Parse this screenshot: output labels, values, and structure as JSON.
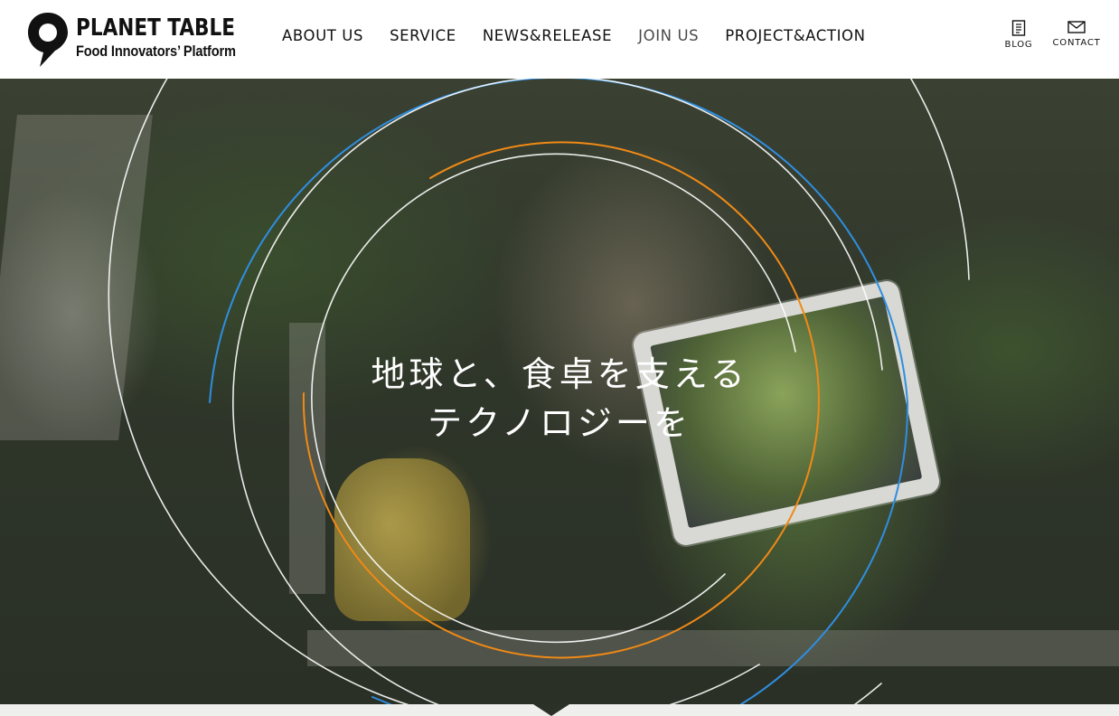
{
  "header": {
    "logo": {
      "title": "PLANET TABLE",
      "subtitle": "Food Innovators’ Platform"
    },
    "nav": [
      {
        "label": "ABOUT US"
      },
      {
        "label": "SERVICE"
      },
      {
        "label": "NEWS&RELEASE"
      },
      {
        "label": "JOIN US"
      },
      {
        "label": "PROJECT&ACTION"
      }
    ],
    "utility": {
      "blog": {
        "label": "BLOG",
        "icon": "document-icon"
      },
      "contact": {
        "label": "CONTACT",
        "icon": "envelope-icon"
      }
    }
  },
  "hero": {
    "tagline_line1": "地球と、食卓を支える",
    "tagline_line2": "テクノロジーを",
    "colors": {
      "ring_white": "#ffffff",
      "ring_blue": "#2f8ee0",
      "ring_orange": "#f08a16"
    }
  }
}
